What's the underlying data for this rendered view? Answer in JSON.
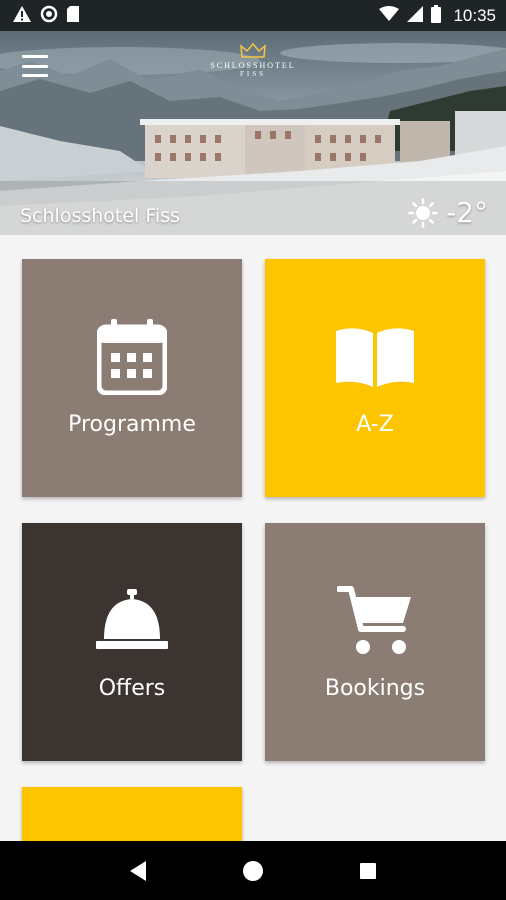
{
  "status_bar": {
    "time": "10:35",
    "icons": [
      "warning-icon",
      "sync-icon",
      "sd-card-icon",
      "wifi-icon",
      "signal-icon",
      "battery-icon"
    ]
  },
  "header": {
    "menu_icon": "hamburger-menu-icon",
    "logo": {
      "line1": "SCHLOSSHOTEL",
      "line2": "FISS",
      "icon": "crown-icon"
    },
    "hotel_name": "Schlosshotel Fiss",
    "weather": {
      "icon": "sun-icon",
      "temperature": "-2°"
    }
  },
  "tiles": [
    {
      "label": "Programme",
      "icon": "calendar-icon",
      "color": "#8b7d73"
    },
    {
      "label": "A-Z",
      "icon": "open-book-icon",
      "color": "#fdc500"
    },
    {
      "label": "Offers",
      "icon": "service-bell-icon",
      "color": "#3b3431"
    },
    {
      "label": "Bookings",
      "icon": "shopping-cart-icon",
      "color": "#8b7d73"
    },
    {
      "label": "",
      "icon": "",
      "color": "#fdc500"
    }
  ],
  "nav_bar": {
    "icons": [
      "back-icon",
      "home-icon",
      "recents-icon"
    ]
  },
  "colors": {
    "accent_yellow": "#fdc500",
    "taupe": "#8b7d73",
    "dark_brown": "#3b3431"
  }
}
